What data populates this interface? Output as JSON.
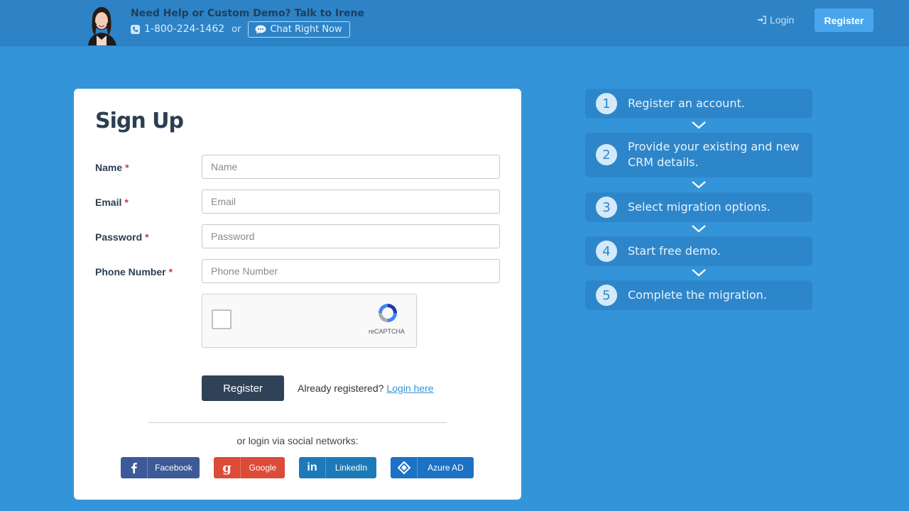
{
  "header": {
    "help_title": "Need Help or Custom Demo? Talk to Irene",
    "phone": "1-800-224-1462",
    "or": "or",
    "chat_label": "Chat Right Now",
    "login_label": "Login",
    "register_label": "Register"
  },
  "signup": {
    "title": "Sign Up",
    "fields": [
      {
        "label": "Name",
        "required": "*",
        "placeholder": "Name",
        "value": ""
      },
      {
        "label": "Email",
        "required": "*",
        "placeholder": "Email",
        "value": ""
      },
      {
        "label": "Password",
        "required": "*",
        "placeholder": "Password",
        "value": ""
      },
      {
        "label": "Phone Number",
        "required": "*",
        "placeholder": "Phone Number",
        "value": ""
      }
    ],
    "captcha_label": "reCAPTCHA",
    "register_button": "Register",
    "already_registered": "Already registered?",
    "login_here": "Login here",
    "social_caption": "or login via social networks:",
    "social": [
      {
        "label": "Facebook",
        "icon": "facebook-icon",
        "color": "#3d5a98"
      },
      {
        "label": "Google",
        "icon": "google-icon",
        "color": "#dc4a38"
      },
      {
        "label": "LinkedIn",
        "icon": "linkedin-icon",
        "color": "#1d7ab9"
      },
      {
        "label": "Azure AD",
        "icon": "azure-ad-icon",
        "color": "#1c72c4"
      }
    ]
  },
  "steps": [
    {
      "num": "1",
      "text": "Register an account."
    },
    {
      "num": "2",
      "text": "Provide your existing and new CRM details."
    },
    {
      "num": "3",
      "text": "Select migration options."
    },
    {
      "num": "4",
      "text": "Start free demo."
    },
    {
      "num": "5",
      "text": "Complete the migration."
    }
  ],
  "colors": {
    "page_background": "#3494d9",
    "header_background": "#2d83c6",
    "primary_button": "#2f4257",
    "accent": "#4aa6ec"
  }
}
